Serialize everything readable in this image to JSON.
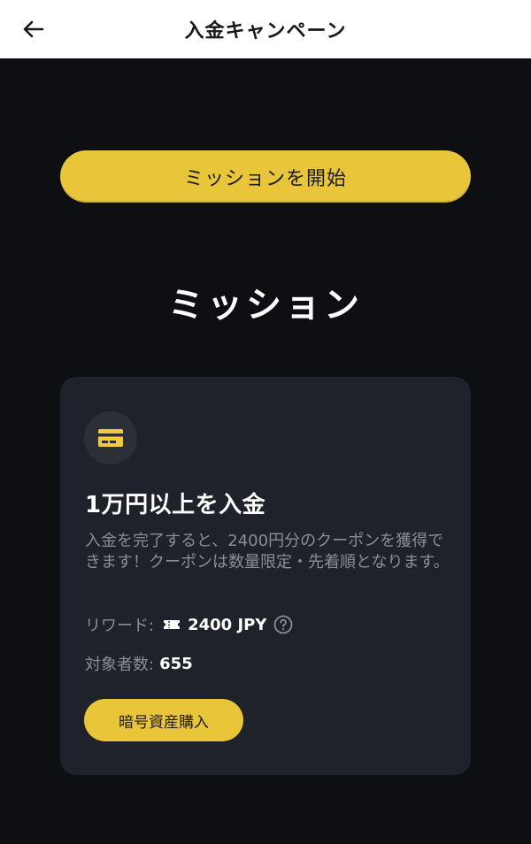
{
  "header": {
    "title": "入金キャンペーン",
    "back_icon": "arrow-left-icon"
  },
  "start_button": {
    "label": "ミッションを開始"
  },
  "section": {
    "title": "ミッション"
  },
  "mission_card": {
    "icon": "credit-card-icon",
    "title": "1万円以上を入金",
    "description": "入金を完了すると、2400円分のクーポンを獲得できます！クーポンは数量限定・先着順となります。",
    "reward_label": "リワード:",
    "reward_icon": "ticket-icon",
    "reward_value": "2400 JPY",
    "help_icon": "question-circle-icon",
    "participants_label": "対象者数:",
    "participants_value": "655",
    "action_label": "暗号資産購入"
  },
  "colors": {
    "background": "#0e0f13",
    "card": "#1f222b",
    "accent": "#e9c53a",
    "muted_text": "#8b8e98"
  }
}
